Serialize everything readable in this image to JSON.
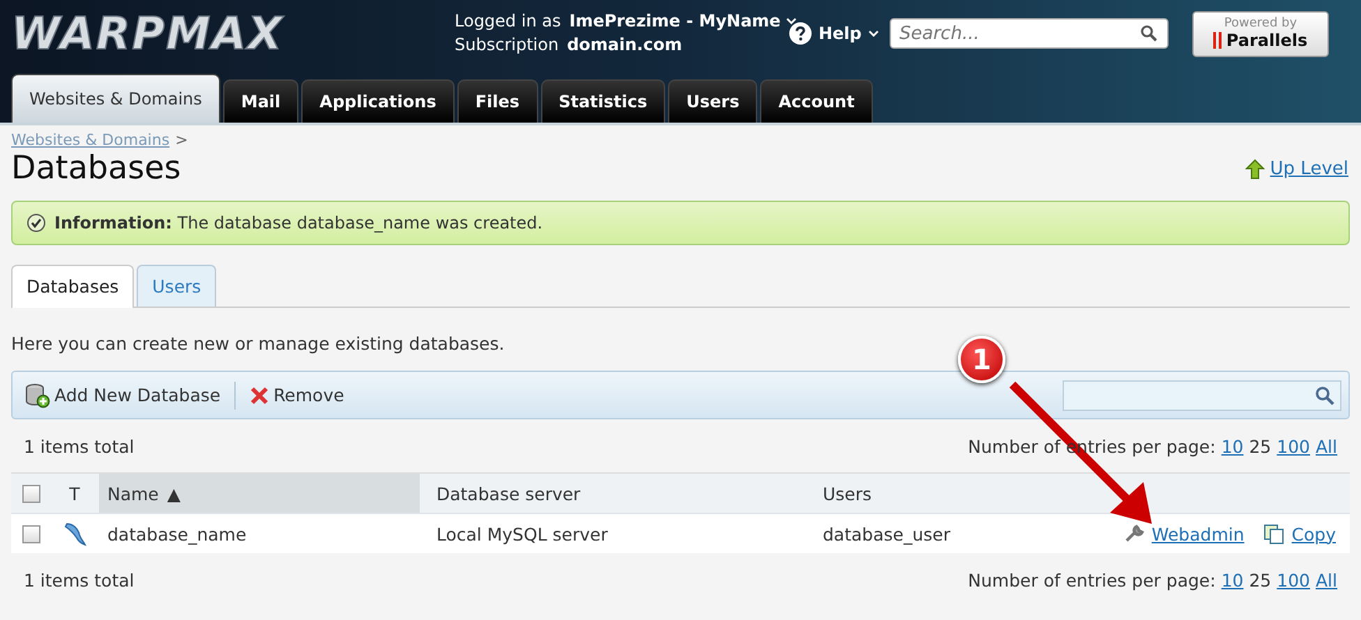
{
  "header": {
    "logo": "WARPMAX",
    "logged_in_label": "Logged in as",
    "user": "ImePrezime - MyName",
    "subscription_label": "Subscription",
    "subscription": "domain.com",
    "help": "Help",
    "search": {
      "placeholder": "Search..."
    },
    "badge": {
      "top": "Powered by",
      "brand": "Parallels"
    }
  },
  "nav_tabs": [
    {
      "label": "Websites & Domains",
      "selected": true
    },
    {
      "label": "Mail",
      "selected": false
    },
    {
      "label": "Applications",
      "selected": false
    },
    {
      "label": "Files",
      "selected": false
    },
    {
      "label": "Statistics",
      "selected": false
    },
    {
      "label": "Users",
      "selected": false
    },
    {
      "label": "Account",
      "selected": false
    }
  ],
  "breadcrumb": [
    {
      "label": "Websites & Domains",
      "separator": ">"
    }
  ],
  "page_title": "Databases",
  "up_level": "Up Level",
  "message": "**Information:** The database database_name was created.",
  "sub_tabs": [
    {
      "label": "Databases",
      "selected": true
    },
    {
      "label": "Users",
      "selected": false
    }
  ],
  "intro": "Here you can create new or manage existing databases.",
  "toolbar": [
    {
      "label": "Add New Database",
      "kind": "add"
    },
    {
      "label": "Remove",
      "kind": "remove"
    }
  ],
  "total_top": "1 items total",
  "pager_top": {
    "label": "Number of entries per page:",
    "options": [
      {
        "label": "10",
        "selected": false
      },
      {
        "label": "25",
        "selected": true
      },
      {
        "label": "100",
        "selected": false
      },
      {
        "label": "All",
        "selected": false
      }
    ]
  },
  "table": {
    "all_checked": false,
    "columns": [
      {
        "label": "T",
        "sorted": false
      },
      {
        "label": "Name",
        "sorted": true,
        "arrow": "▲"
      },
      {
        "label": "Database server",
        "sorted": false
      },
      {
        "label": "Users",
        "sorted": false
      }
    ],
    "rows": [
      {
        "checked": false,
        "name": "database_name",
        "server": "Local MySQL server",
        "user": "database_user",
        "actions": [
          {
            "label": "Webadmin",
            "kind": "webadmin"
          },
          {
            "label": "Copy",
            "kind": "copy"
          }
        ]
      }
    ]
  },
  "total_bottom": "1 items total",
  "pager_bottom": {
    "label": "Number of entries per page:",
    "options": [
      {
        "label": "10",
        "selected": false
      },
      {
        "label": "25",
        "selected": true
      },
      {
        "label": "100",
        "selected": false
      },
      {
        "label": "All",
        "selected": false
      }
    ]
  },
  "callout": {
    "number": "1"
  }
}
